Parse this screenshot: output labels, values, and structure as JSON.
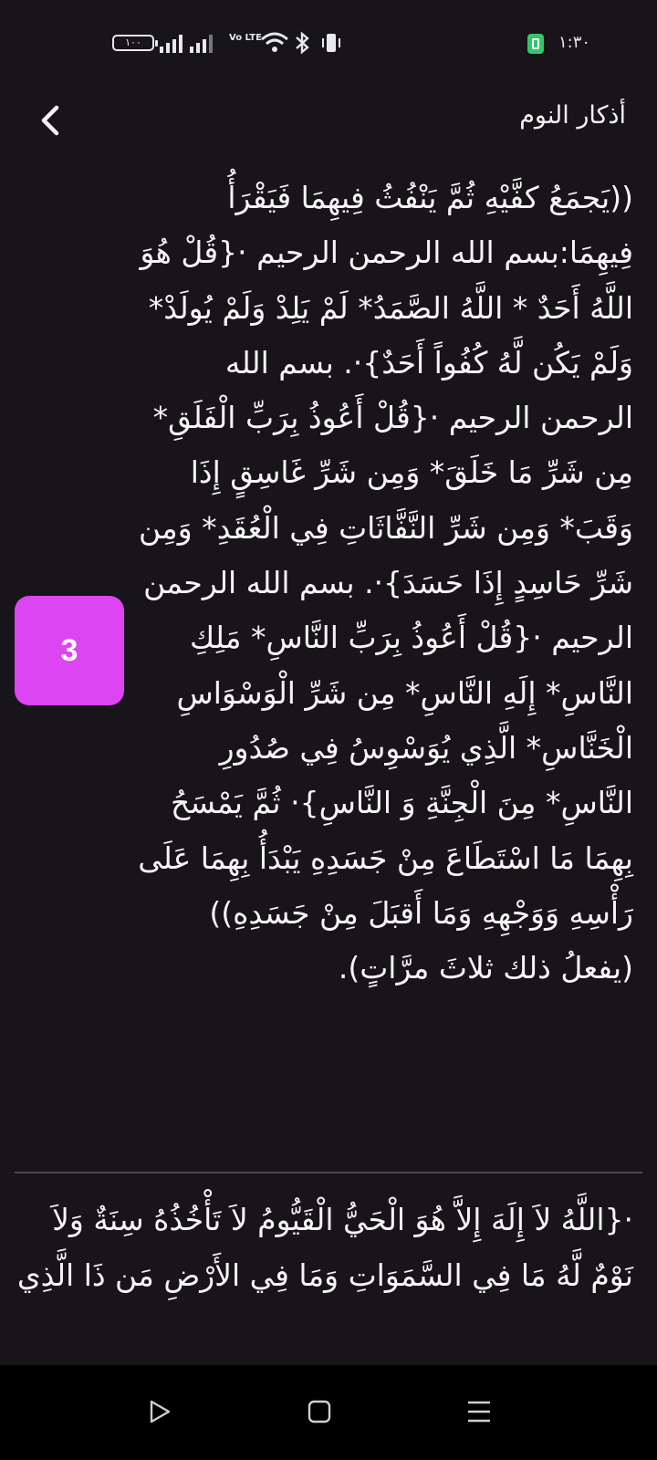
{
  "status_bar": {
    "battery_level": "١٠٠",
    "volte_label": "Vo LTE",
    "time": "١:٣٠"
  },
  "header": {
    "title": "أذكار النوم"
  },
  "main": {
    "zekr_text": "((يَجمَعُ كفَّيْهِ ثُمَّ يَنْفُثُ فِيهِمَا فَيَقْرَأُ فِيهِمَا:بسم الله الرحمن الرحيم ·{قُلْ هُوَ اللَّهُ أَحَدٌ * اللَّهُ الصَّمَدُ* لَمْ يَلِدْ وَلَمْ يُولَدْ* وَلَمْ يَكُن لَّهُ كُفُواً أَحَدٌ}·. بسم الله الرحمن الرحيم ·{قُلْ أَعُوذُ بِرَبِّ الْفَلَقِ* مِن شَرِّ مَا خَلَقَ* وَمِن شَرِّ غَاسِقٍ إِذَا وَقَبَ* وَمِن شَرِّ النَّفَّاثَاتِ فِي الْعُقَدِ* وَمِن شَرِّ حَاسِدٍ إِذَا حَسَدَ}·.  بسم الله الرحمن الرحيم ·{قُلْ أَعُوذُ بِرَبِّ النَّاسِ* مَلِكِ النَّاسِ* إِلَهِ النَّاسِ* مِن شَرِّ الْوَسْوَاسِ الْخَنَّاسِ* الَّذِي يُوَسْوِسُ فِي صُدُورِ النَّاسِ* مِنَ الْجِنَّةِ وَ النَّاسِ}· ثُمَّ يَمْسَحُ بِهِمَا مَا اسْتَطَاعَ مِنْ جَسَدِهِ يَبْدَأُ بِهِمَا عَلَى رَأْسِهِ وَوَجْهِهِ وَمَا أَقبَلَ مِنْ جَسَدِهِ)) (يفعلُ ذلك ثلاثَ مرَّاتٍ).",
    "counter": "3",
    "next_zekr_text": "·{اللَّهُ لاَ إِلَهَ إِلاَّ هُوَ الْحَيُّ الْقَيُّومُ لاَ تَأْخُذُهُ سِنَةٌ وَلاَ نَوْمٌ لَّهُ مَا فِي السَّمَوَاتِ وَمَا فِي الأَرْضِ مَن ذَا الَّذِي"
  }
}
